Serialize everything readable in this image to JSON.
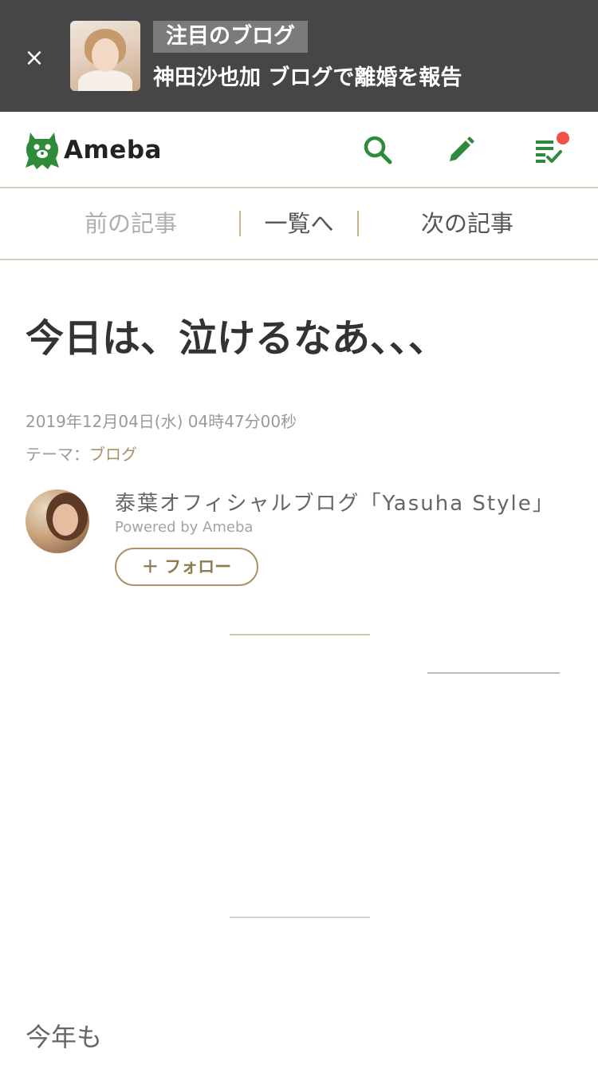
{
  "banner": {
    "close_icon": "×",
    "tag": "注目のブログ",
    "headline": "神田沙也加 ブログで離婚を報告"
  },
  "header": {
    "logo_text": "Ameba",
    "brand_color": "#2e8b3a",
    "icons": [
      "search-icon",
      "edit-icon",
      "feed-icon"
    ],
    "notification_dot_color": "#f0524a"
  },
  "article_nav": {
    "prev": "前の記事",
    "list": "一覧へ",
    "next": "次の記事"
  },
  "article": {
    "title": "今日は、泣けるなあ、、、",
    "date": "2019年12月04日(水) 04時47分00秒",
    "theme_label": "テーマ：",
    "theme_value": "ブログ",
    "body_start": "今年も"
  },
  "author": {
    "blog_name": "泰葉オフィシャルブログ「Yasuha Style」",
    "powered_by": "Powered by Ameba",
    "follow_label": "＋ フォロー"
  }
}
